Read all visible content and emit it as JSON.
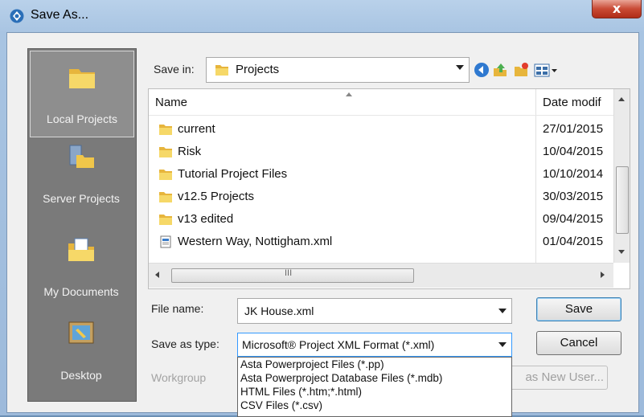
{
  "window": {
    "title": "Save As...",
    "close_label": "x"
  },
  "places": [
    {
      "label": "Local Projects",
      "icon": "folder-icon",
      "selected": true
    },
    {
      "label": "Server Projects",
      "icon": "server-folder-icon",
      "selected": false
    },
    {
      "label": "My Documents",
      "icon": "documents-folder-icon",
      "selected": false
    },
    {
      "label": "Desktop",
      "icon": "desktop-icon",
      "selected": false
    }
  ],
  "save_in": {
    "label": "Save in:",
    "value": "Projects"
  },
  "file_list": {
    "columns": [
      "Name",
      "Date modif"
    ],
    "rows": [
      {
        "name": "current",
        "date": "27/01/2015",
        "type": "folder"
      },
      {
        "name": "Risk",
        "date": "10/04/2015",
        "type": "folder"
      },
      {
        "name": "Tutorial Project Files",
        "date": "10/10/2014",
        "type": "folder"
      },
      {
        "name": "v12.5 Projects",
        "date": "30/03/2015",
        "type": "folder"
      },
      {
        "name": "v13 edited",
        "date": "09/04/2015",
        "type": "folder"
      },
      {
        "name": "Western Way, Nottigham.xml",
        "date": "01/04/2015",
        "type": "xml-file"
      }
    ],
    "hscroll_glyph": "III"
  },
  "file_name": {
    "label": "File name:",
    "value": "JK House.xml"
  },
  "save_as_type": {
    "label": "Save as type:",
    "value": "Microsoft® Project XML Format (*.xml)",
    "options": [
      "Asta Powerproject Files (*.pp)",
      "Asta Powerproject Database Files (*.mdb)",
      "HTML Files (*.htm;*.html)",
      "CSV Files (*.csv)"
    ]
  },
  "workgroup": {
    "label": "Workgroup",
    "button_fragment": "as New User..."
  },
  "buttons": {
    "save": "Save",
    "cancel": "Cancel"
  },
  "colors": {
    "places_bg": "#7a7a7a",
    "selection_border": "#3399ff",
    "folder": "#e8b840"
  }
}
